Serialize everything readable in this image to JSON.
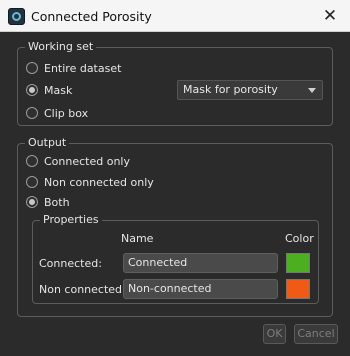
{
  "window": {
    "title": "Connected Porosity",
    "close_glyph": "✕"
  },
  "working_set": {
    "title": "Working set",
    "options": [
      {
        "label": "Entire dataset",
        "checked": false
      },
      {
        "label": "Mask",
        "checked": true
      },
      {
        "label": "Clip box",
        "checked": false
      }
    ],
    "mask_select": {
      "value": "Mask for porosity"
    }
  },
  "output": {
    "title": "Output",
    "options": [
      {
        "label": "Connected only",
        "checked": false
      },
      {
        "label": "Non connected only",
        "checked": false
      },
      {
        "label": "Both",
        "checked": true
      }
    ],
    "properties": {
      "title": "Properties",
      "name_header": "Name",
      "color_header": "Color",
      "rows": [
        {
          "label": "Connected:",
          "name": "Connected",
          "color": "#4caf1f"
        },
        {
          "label": "Non connected:",
          "name": "Non-connected",
          "color": "#f05a14"
        }
      ]
    }
  },
  "buttons": {
    "ok": "OK",
    "cancel": "Cancel"
  }
}
